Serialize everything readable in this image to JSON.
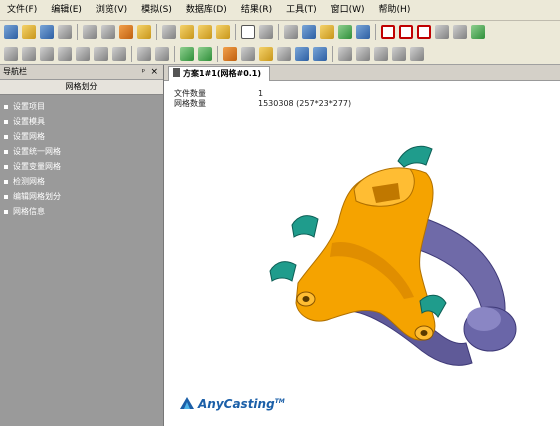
{
  "menu": [
    "文件(F)",
    "编辑(E)",
    "浏览(V)",
    "模拟(S)",
    "数据库(D)",
    "结果(R)",
    "工具(T)",
    "窗口(W)",
    "帮助(H)"
  ],
  "panel": {
    "title": "导航栏",
    "pin": "ᵖ",
    "close": "×",
    "header": "网格划分",
    "items": [
      "设置项目",
      "设置模具",
      "设置网格",
      "设置统一网格",
      "设置变量网格",
      "检测网格",
      "编辑网格划分",
      "网格信息"
    ]
  },
  "document": {
    "tab_label": "方案1#1(网格#0.1)",
    "rows": [
      {
        "label": "文件数量",
        "value": "1"
      },
      {
        "label": "网格数量",
        "value": "1530308 (257*23*277)"
      }
    ],
    "logo_text": "AnyCasting",
    "logo_tm": "TM"
  },
  "colors": {
    "casting": "#f5a300",
    "mold": "#6f6aa8",
    "core": "#1f9c8c"
  }
}
